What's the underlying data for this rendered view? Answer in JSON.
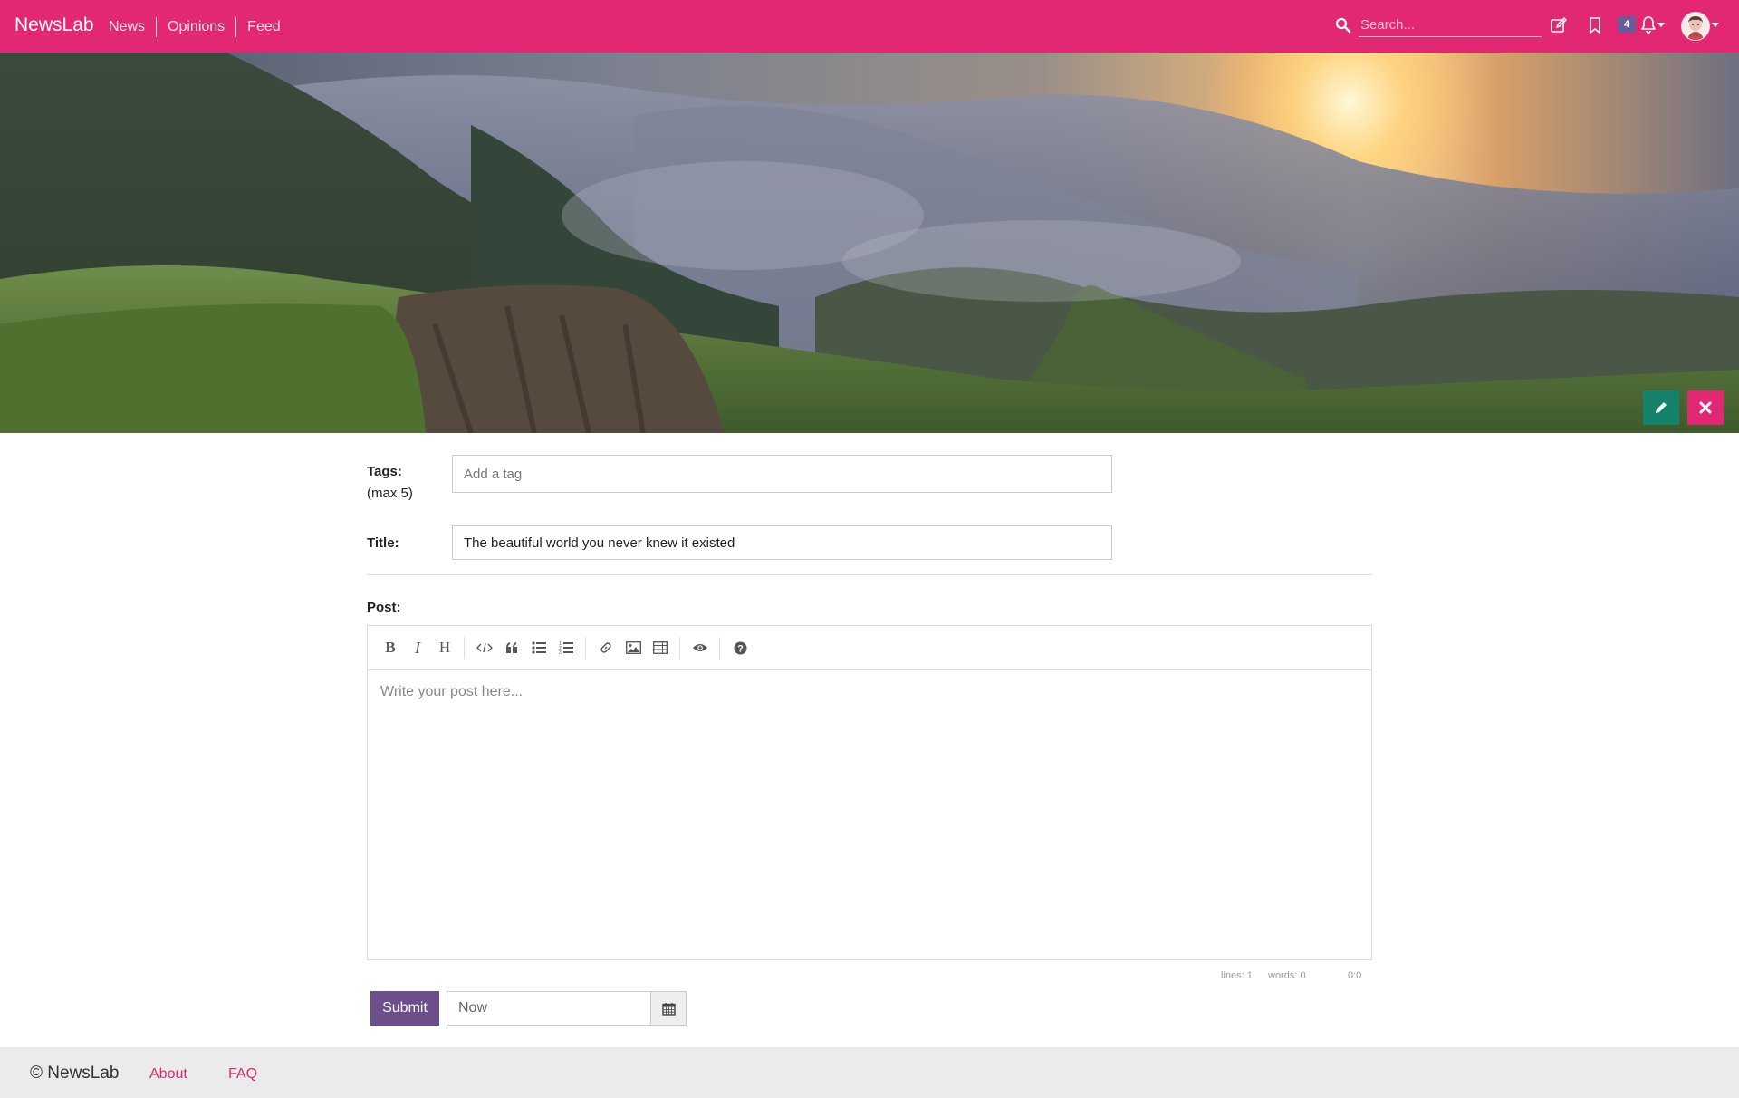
{
  "nav": {
    "brand": "NewsLab",
    "links": [
      "News",
      "Opinions",
      "Feed"
    ],
    "search_placeholder": "Search...",
    "notification_count": "4",
    "icons": [
      "search-icon",
      "compose-icon",
      "bookmark-icon",
      "bell-icon",
      "avatar"
    ]
  },
  "hero": {
    "image": "mountain landscape with clouds and sunset",
    "edit_icon": "pencil-icon",
    "remove_icon": "close-icon"
  },
  "form": {
    "tags_label": "Tags:",
    "tags_sublabel": "(max 5)",
    "tags_placeholder": "Add a tag",
    "title_label": "Title:",
    "title_value": "The beautiful world you never knew it existed",
    "post_label": "Post:",
    "post_placeholder": "Write your post here...",
    "toolbar": [
      "bold",
      "italic",
      "heading",
      "code",
      "quote",
      "unordered-list",
      "ordered-list",
      "link",
      "image",
      "table",
      "preview",
      "help"
    ],
    "status_lines": "lines: 1",
    "status_words": "words: 0",
    "status_cursor": "0:0",
    "submit_label": "Submit",
    "schedule_placeholder": "Now"
  },
  "footer": {
    "copyright": "© NewsLab",
    "links": [
      "About",
      "FAQ"
    ]
  },
  "colors": {
    "primary": "#e22872",
    "submit": "#6b4e8a",
    "edit_button": "#15826b",
    "badge": "#6b5b95"
  }
}
